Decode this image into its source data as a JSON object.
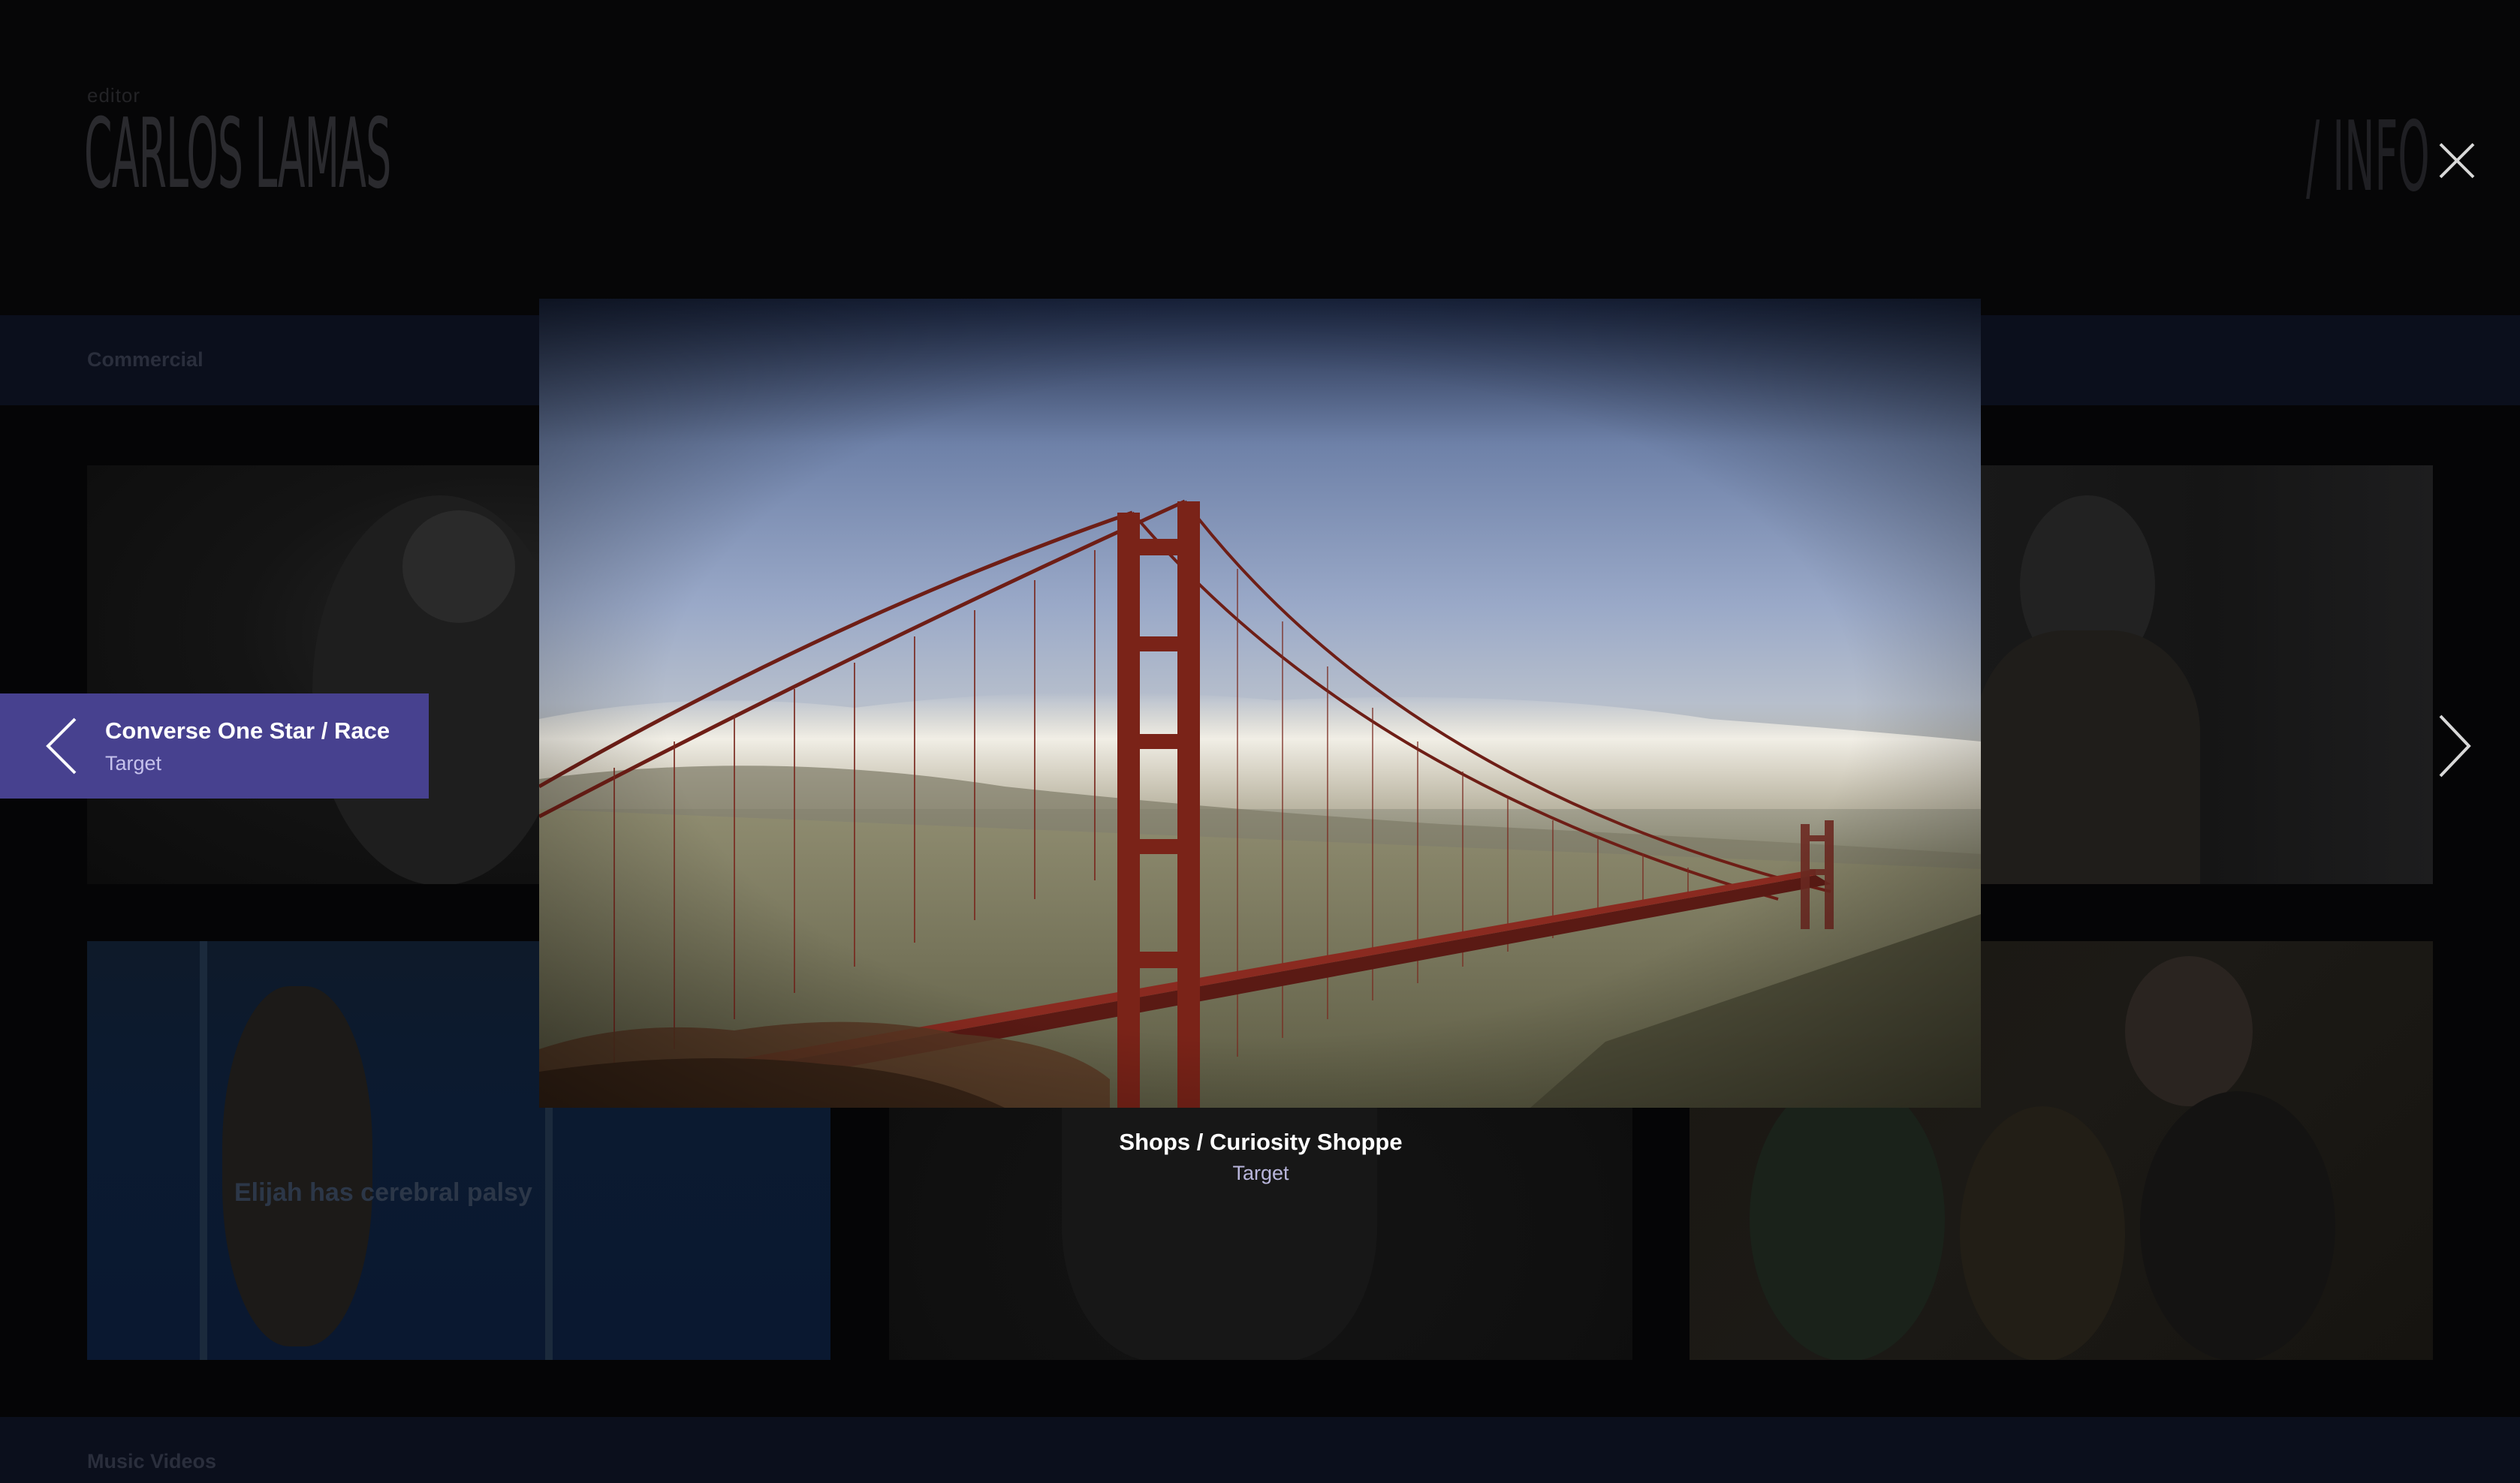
{
  "site": {
    "role": "editor",
    "name": "CARLOS LAMAS",
    "nav_label": "/ INFO",
    "sections": [
      "Commercial",
      "Music Videos"
    ]
  },
  "thumbnails": [
    {
      "caption": ""
    },
    {
      "caption": ""
    },
    {
      "caption": ""
    },
    {
      "caption": "Elijah has cerebral palsy"
    },
    {
      "caption": ""
    },
    {
      "caption": ""
    }
  ],
  "lightbox": {
    "title": "Shops / Curiosity Shoppe",
    "client": "Target",
    "image_subject": "golden-gate-bridge",
    "previous": {
      "title": "Converse One Star / Race",
      "client": "Target"
    },
    "accent_color": "#47418f"
  },
  "icons": {
    "close": "close-icon",
    "previous": "chevron-left-icon",
    "next": "chevron-right-icon"
  }
}
